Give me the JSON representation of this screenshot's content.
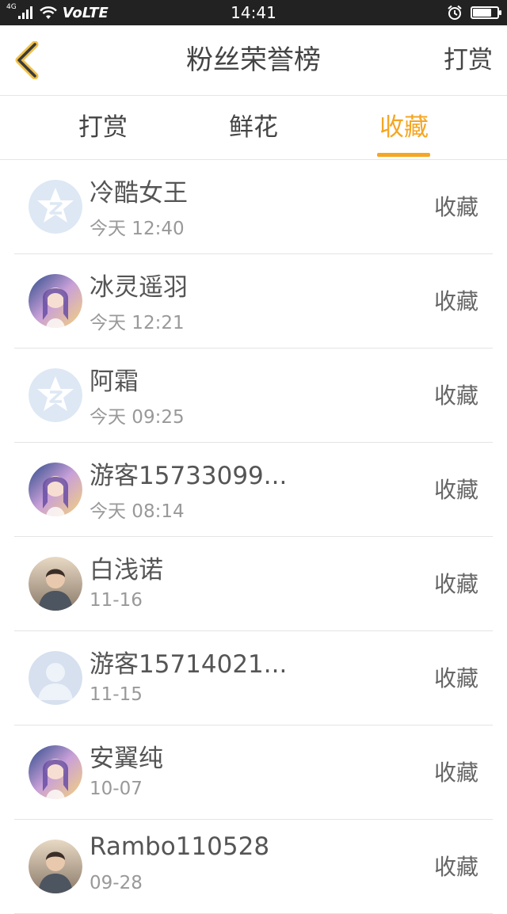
{
  "status_bar": {
    "network": "4G",
    "carrier": "VoLTE",
    "time": "14:41",
    "battery_level": 0.75
  },
  "header": {
    "title": "粉丝荣誉榜",
    "action_label": "打赏"
  },
  "tabs": [
    {
      "label": "打赏",
      "active": false
    },
    {
      "label": "鲜花",
      "active": false
    },
    {
      "label": "收藏",
      "active": true
    }
  ],
  "colors": {
    "accent": "#f5a623",
    "status_bar": "#222222"
  },
  "fans": [
    {
      "name": "冷酷女王",
      "time": "今天 12:40",
      "status": "收藏",
      "avatar": "default-qq-avatar"
    },
    {
      "name": "冰灵遥羽",
      "time": "今天 12:21",
      "status": "收藏",
      "avatar": "anime-girl-avatar"
    },
    {
      "name": "阿霜",
      "time": "今天 09:25",
      "status": "收藏",
      "avatar": "default-qq-avatar"
    },
    {
      "name": "游客15733099...",
      "time": "今天 08:14",
      "status": "收藏",
      "avatar": "anime-girl-avatar"
    },
    {
      "name": "白浅诺",
      "time": "11-16",
      "status": "收藏",
      "avatar": "photo-avatar"
    },
    {
      "name": "游客15714021...",
      "time": "11-15",
      "status": "收藏",
      "avatar": "default-person-avatar"
    },
    {
      "name": "安翼纯",
      "time": "10-07",
      "status": "收藏",
      "avatar": "anime-girl-avatar"
    },
    {
      "name": "Rambo110528",
      "time": "09-28",
      "status": "收藏",
      "avatar": "photo-avatar"
    }
  ]
}
